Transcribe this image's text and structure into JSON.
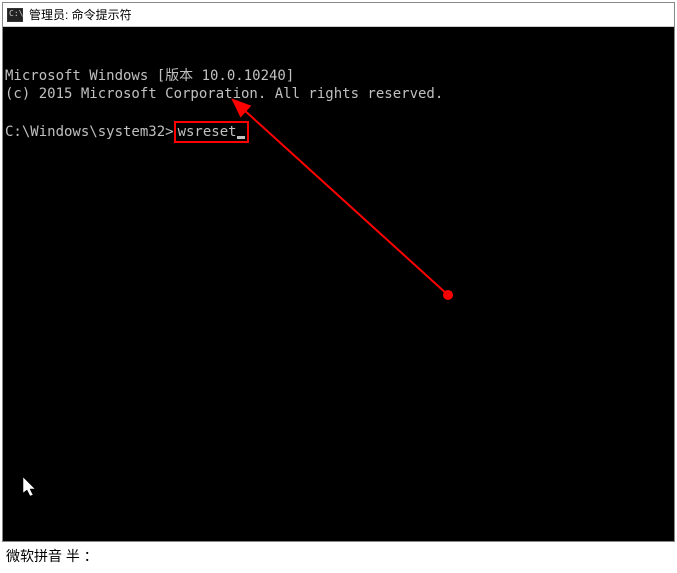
{
  "window": {
    "title": "管理员: 命令提示符"
  },
  "terminal": {
    "line1": "Microsoft Windows [版本 10.0.10240]",
    "line2": "(c) 2015 Microsoft Corporation. All rights reserved.",
    "prompt": "C:\\Windows\\system32>",
    "command": "wsreset"
  },
  "ime": {
    "text": "微软拼音 半 ："
  },
  "annotation": {
    "highlight_color": "#ff0000"
  }
}
